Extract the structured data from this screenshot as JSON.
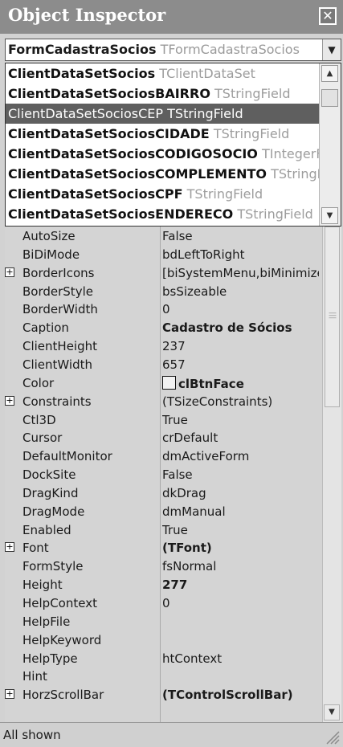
{
  "window": {
    "title": "Object Inspector",
    "close_glyph": "✕"
  },
  "object_selector": {
    "name": "FormCadastraSocios",
    "type": "TFormCadastraSocios"
  },
  "dropdown": {
    "items": [
      {
        "name": "ClientDataSetSocios",
        "type": "TClientDataSet"
      },
      {
        "name": "ClientDataSetSociosBAIRRO",
        "type": "TStringField"
      },
      {
        "name": "ClientDataSetSociosCEP",
        "type": "TStringField",
        "selected": true
      },
      {
        "name": "ClientDataSetSociosCIDADE",
        "type": "TStringField"
      },
      {
        "name": "ClientDataSetSociosCODIGOSOCIO",
        "type": "TIntegerField"
      },
      {
        "name": "ClientDataSetSociosCOMPLEMENTO",
        "type": "TStringField"
      },
      {
        "name": "ClientDataSetSociosCPF",
        "type": "TStringField"
      },
      {
        "name": "ClientDataSetSociosENDERECO",
        "type": "TStringField"
      }
    ]
  },
  "properties": [
    {
      "name": "AutoSize",
      "value": "False"
    },
    {
      "name": "BiDiMode",
      "value": "bdLeftToRight"
    },
    {
      "name": "BorderIcons",
      "value": "[biSystemMenu,biMinimize,biMaximize]",
      "expandable": true
    },
    {
      "name": "BorderStyle",
      "value": "bsSizeable"
    },
    {
      "name": "BorderWidth",
      "value": "0"
    },
    {
      "name": "Caption",
      "value": "Cadastro de Sócios",
      "bold": true
    },
    {
      "name": "ClientHeight",
      "value": "237"
    },
    {
      "name": "ClientWidth",
      "value": "657"
    },
    {
      "name": "Color",
      "value": "clBtnFace",
      "bold": true,
      "swatch": true
    },
    {
      "name": "Constraints",
      "value": "(TSizeConstraints)",
      "expandable": true
    },
    {
      "name": "Ctl3D",
      "value": "True"
    },
    {
      "name": "Cursor",
      "value": "crDefault"
    },
    {
      "name": "DefaultMonitor",
      "value": "dmActiveForm"
    },
    {
      "name": "DockSite",
      "value": "False"
    },
    {
      "name": "DragKind",
      "value": "dkDrag"
    },
    {
      "name": "DragMode",
      "value": "dmManual"
    },
    {
      "name": "Enabled",
      "value": "True"
    },
    {
      "name": "Font",
      "value": "(TFont)",
      "bold": true,
      "expandable": true
    },
    {
      "name": "FormStyle",
      "value": "fsNormal"
    },
    {
      "name": "Height",
      "value": "277",
      "bold": true
    },
    {
      "name": "HelpContext",
      "value": "0"
    },
    {
      "name": "HelpFile",
      "value": ""
    },
    {
      "name": "HelpKeyword",
      "value": ""
    },
    {
      "name": "HelpType",
      "value": "htContext"
    },
    {
      "name": "Hint",
      "value": ""
    },
    {
      "name": "HorzScrollBar",
      "value": "(TControlScrollBar)",
      "bold": true,
      "expandable": true
    }
  ],
  "expand_glyph": "+",
  "status": {
    "text": "All shown"
  }
}
